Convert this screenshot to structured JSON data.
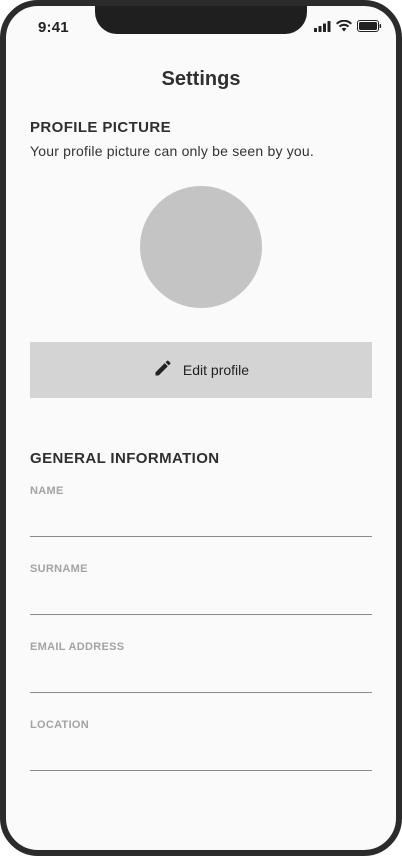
{
  "status_bar": {
    "time": "9:41"
  },
  "header": {
    "title": "Settings"
  },
  "profile_picture": {
    "title": "PROFILE PICTURE",
    "description": "Your profile picture can only be seen by you.",
    "edit_button_label": "Edit profile"
  },
  "general_information": {
    "title": "GENERAL INFORMATION",
    "fields": [
      {
        "label": "NAME",
        "value": ""
      },
      {
        "label": "SURNAME",
        "value": ""
      },
      {
        "label": "EMAIL ADDRESS",
        "value": ""
      },
      {
        "label": "LOCATION",
        "value": ""
      }
    ]
  },
  "colors": {
    "background": "#fafafa",
    "avatar_placeholder": "#c4c4c4",
    "button_background": "#d4d4d4",
    "field_label": "#a3a3a3"
  },
  "icons": [
    "signal-icon",
    "wifi-icon",
    "battery-icon",
    "pencil-icon"
  ]
}
